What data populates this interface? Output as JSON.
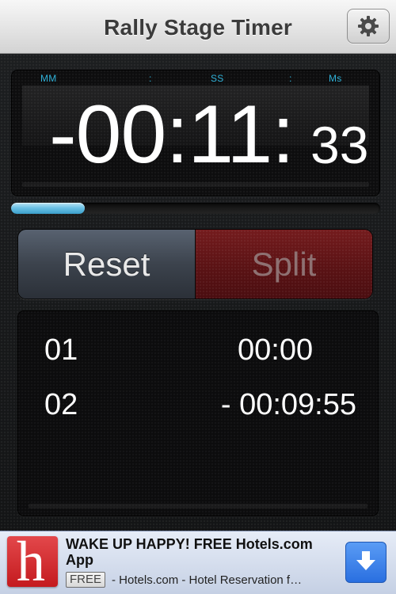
{
  "nav": {
    "title": "Rally Stage Timer",
    "settings_icon": "gear-icon"
  },
  "timer": {
    "labels": {
      "minutes": "MM",
      "sep1": ":",
      "seconds": "SS",
      "sep2": ":",
      "ms": "Ms"
    },
    "display_main": "-00:11:",
    "display_ms": "33",
    "label_color": "#2fb1d8"
  },
  "progress": {
    "fraction": 0.2
  },
  "controls": {
    "reset_label": "Reset",
    "split_label": "Split"
  },
  "splits": [
    {
      "index": "01",
      "time": "00:00"
    },
    {
      "index": "02",
      "time": "- 00:09:55"
    }
  ],
  "ad": {
    "logo_letter": "h",
    "headline": "WAKE UP HAPPY! FREE Hotels.com App",
    "badge": "FREE",
    "description": "- Hotels.com - Hotel Reservation f…",
    "download_icon": "download-arrow-icon"
  }
}
